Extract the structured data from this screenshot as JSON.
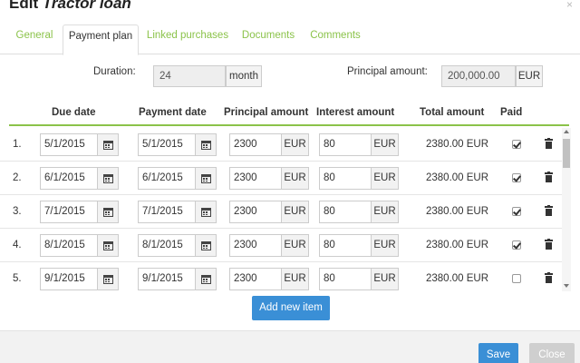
{
  "dialog": {
    "title_prefix": "Edit ",
    "title_name": "Tractor loan",
    "close_glyph": "×"
  },
  "tabs": [
    {
      "label": "General",
      "active": false
    },
    {
      "label": "Payment plan",
      "active": true
    },
    {
      "label": "Linked purchases",
      "active": false
    },
    {
      "label": "Documents",
      "active": false
    },
    {
      "label": "Comments",
      "active": false
    }
  ],
  "summary": {
    "duration_label": "Duration:",
    "duration_value": "24",
    "duration_unit": "month",
    "principal_label": "Principal amount:",
    "principal_value": "200,000.00",
    "principal_currency": "EUR"
  },
  "table": {
    "headers": {
      "due_date": "Due date",
      "payment_date": "Payment date",
      "principal_amount": "Principal amount",
      "interest_amount": "Interest amount",
      "total_amount": "Total amount",
      "paid": "Paid"
    },
    "rows": [
      {
        "num": "1.",
        "due": "5/1/2015",
        "payment": "5/1/2015",
        "principal": "2300",
        "principal_cur": "EUR",
        "interest": "80",
        "interest_cur": "EUR",
        "total": "2380.00 EUR",
        "paid": true
      },
      {
        "num": "2.",
        "due": "6/1/2015",
        "payment": "6/1/2015",
        "principal": "2300",
        "principal_cur": "EUR",
        "interest": "80",
        "interest_cur": "EUR",
        "total": "2380.00 EUR",
        "paid": true
      },
      {
        "num": "3.",
        "due": "7/1/2015",
        "payment": "7/1/2015",
        "principal": "2300",
        "principal_cur": "EUR",
        "interest": "80",
        "interest_cur": "EUR",
        "total": "2380.00 EUR",
        "paid": true
      },
      {
        "num": "4.",
        "due": "8/1/2015",
        "payment": "8/1/2015",
        "principal": "2300",
        "principal_cur": "EUR",
        "interest": "80",
        "interest_cur": "EUR",
        "total": "2380.00 EUR",
        "paid": true
      },
      {
        "num": "5.",
        "due": "9/1/2015",
        "payment": "9/1/2015",
        "principal": "2300",
        "principal_cur": "EUR",
        "interest": "80",
        "interest_cur": "EUR",
        "total": "2380.00 EUR",
        "paid": false
      }
    ]
  },
  "buttons": {
    "add_new_item": "Add new item",
    "save": "Save",
    "close": "Close"
  },
  "icons": {
    "calendar": "calendar-icon",
    "trash": "trash-icon"
  },
  "colors": {
    "accent_green": "#8bc34a",
    "primary_blue": "#3a8fd6",
    "disabled_gray": "#cfcfcf"
  }
}
